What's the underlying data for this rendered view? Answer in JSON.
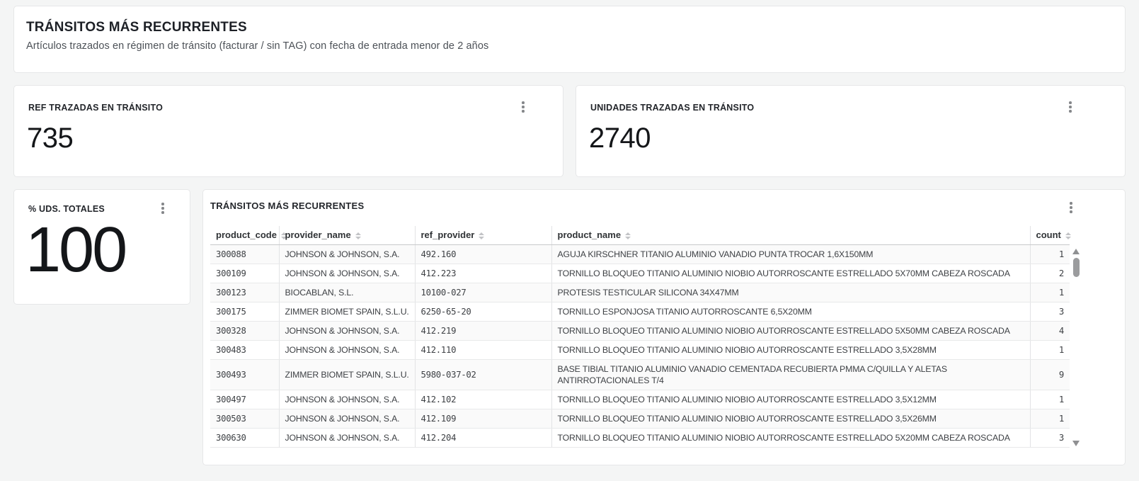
{
  "header": {
    "title": "TRÁNSITOS MÁS RECURRENTES",
    "subtitle": "Artículos trazados en régimen de tránsito (facturar / sin TAG) con fecha de entrada menor de 2 años"
  },
  "stats": [
    {
      "label": "REF TRAZADAS EN TRÁNSITO",
      "value": "735"
    },
    {
      "label": "UNIDADES TRAZADAS EN TRÁNSITO",
      "value": "2740"
    },
    {
      "label": "% UDS. TOTALES",
      "value": "100"
    }
  ],
  "table": {
    "title": "TRÁNSITOS MÁS RECURRENTES",
    "columns": [
      "product_code",
      "provider_name",
      "ref_provider",
      "product_name",
      "count"
    ],
    "rows": [
      {
        "product_code": "300088",
        "provider_name": "JOHNSON & JOHNSON, S.A.",
        "ref_provider": "492.160",
        "product_name": "AGUJA KIRSCHNER TITANIO ALUMINIO VANADIO PUNTA TROCAR 1,6X150MM",
        "count": 1
      },
      {
        "product_code": "300109",
        "provider_name": "JOHNSON & JOHNSON, S.A.",
        "ref_provider": "412.223",
        "product_name": "TORNILLO BLOQUEO TITANIO ALUMINIO NIOBIO AUTORROSCANTE ESTRELLADO 5X70MM CABEZA ROSCADA",
        "count": 2
      },
      {
        "product_code": "300123",
        "provider_name": "BIOCABLAN, S.L.",
        "ref_provider": "10100-027",
        "product_name": "PROTESIS TESTICULAR SILICONA 34X47MM",
        "count": 1
      },
      {
        "product_code": "300175",
        "provider_name": "ZIMMER BIOMET SPAIN, S.L.U.",
        "ref_provider": "6250-65-20",
        "product_name": "TORNILLO ESPONJOSA TITANIO AUTORROSCANTE 6,5X20MM",
        "count": 3
      },
      {
        "product_code": "300328",
        "provider_name": "JOHNSON & JOHNSON, S.A.",
        "ref_provider": "412.219",
        "product_name": "TORNILLO BLOQUEO TITANIO ALUMINIO NIOBIO AUTORROSCANTE ESTRELLADO 5X50MM CABEZA ROSCADA",
        "count": 4
      },
      {
        "product_code": "300483",
        "provider_name": "JOHNSON & JOHNSON, S.A.",
        "ref_provider": "412.110",
        "product_name": "TORNILLO BLOQUEO TITANIO ALUMINIO NIOBIO AUTORROSCANTE ESTRELLADO 3,5X28MM",
        "count": 1
      },
      {
        "product_code": "300493",
        "provider_name": "ZIMMER BIOMET SPAIN, S.L.U.",
        "ref_provider": "5980-037-02",
        "product_name": "BASE TIBIAL TITANIO ALUMINIO VANADIO CEMENTADA RECUBIERTA PMMA C/QUILLA Y ALETAS ANTIRROTACIONALES T/4",
        "count": 9
      },
      {
        "product_code": "300497",
        "provider_name": "JOHNSON & JOHNSON, S.A.",
        "ref_provider": "412.102",
        "product_name": "TORNILLO BLOQUEO TITANIO ALUMINIO NIOBIO AUTORROSCANTE ESTRELLADO 3,5X12MM",
        "count": 1
      },
      {
        "product_code": "300503",
        "provider_name": "JOHNSON & JOHNSON, S.A.",
        "ref_provider": "412.109",
        "product_name": "TORNILLO BLOQUEO TITANIO ALUMINIO NIOBIO AUTORROSCANTE ESTRELLADO 3,5X26MM",
        "count": 1
      },
      {
        "product_code": "300630",
        "provider_name": "JOHNSON & JOHNSON, S.A.",
        "ref_provider": "412.204",
        "product_name": "TORNILLO BLOQUEO TITANIO ALUMINIO NIOBIO AUTORROSCANTE ESTRELLADO 5X20MM CABEZA ROSCADA",
        "count": 3
      }
    ]
  },
  "icons": {
    "panel_menu": "kebab-vertical-dots",
    "sort": "sort-carets-up-down",
    "scrollbar_up": "triangle-up",
    "scrollbar_down": "triangle-down"
  },
  "colors": {
    "page_bg": "#f4f5f5",
    "panel_bg": "#ffffff",
    "text_primary": "#1d2026",
    "value_text": "#141619",
    "grid_line": "#e8e9ea",
    "header_rule": "#c8c9cb"
  }
}
